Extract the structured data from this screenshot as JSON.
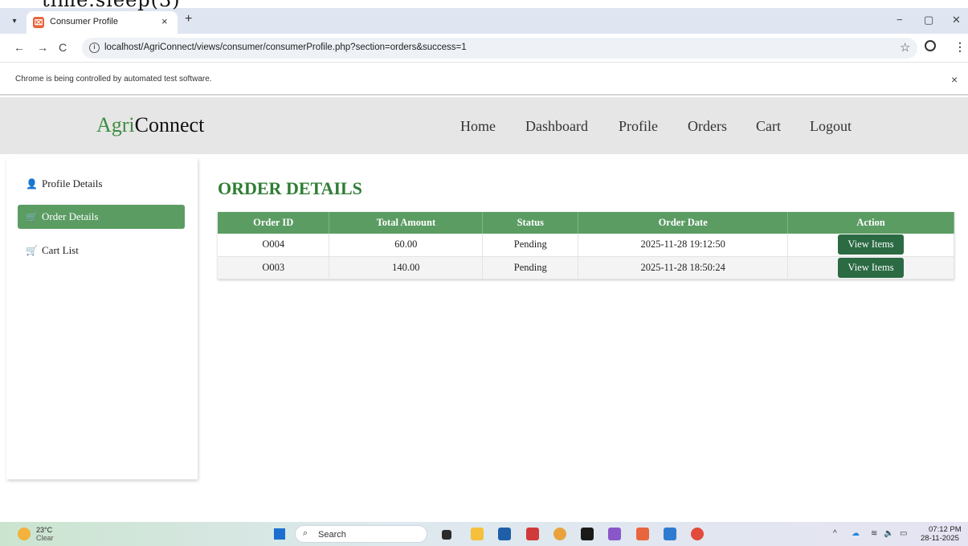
{
  "overlay_code": "time.sleep(3)",
  "browser": {
    "tab_title": "Consumer Profile",
    "tab_close": "×",
    "new_tab": "+",
    "url": "localhost/AgriConnect/views/consumer/consumerProfile.php?section=orders&success=1",
    "automation_notice": "Chrome is being controlled by automated test software.",
    "bar_close": "×",
    "back": "←",
    "forward": "→",
    "reload": "C",
    "bookmark": "☆",
    "menu": "⋮",
    "minimize": "−",
    "restore": "▢",
    "close": "✕",
    "tab_menu": "▾"
  },
  "site": {
    "logo_part1": "Agri",
    "logo_part2": "Connect",
    "nav": {
      "home": "Home",
      "dashboard": "Dashboard",
      "profile": "Profile",
      "orders": "Orders",
      "cart": "Cart",
      "logout": "Logout"
    }
  },
  "sidebar": {
    "profile_details": "Profile Details",
    "order_details": "Order Details",
    "cart_list": "Cart List"
  },
  "main": {
    "title": "ORDER DETAILS",
    "table": {
      "headers": [
        "Order ID",
        "Total Amount",
        "Status",
        "Order Date",
        "Action"
      ],
      "rows": [
        {
          "id": "O004",
          "total": "60.00",
          "status": "Pending",
          "date": "2025-11-28 19:12:50",
          "action": "View Items"
        },
        {
          "id": "O003",
          "total": "140.00",
          "status": "Pending",
          "date": "2025-11-28 18:50:24",
          "action": "View Items"
        }
      ]
    }
  },
  "taskbar": {
    "temp": "23°C",
    "weather": "Clear",
    "search": "Search",
    "time": "07:12 PM",
    "date": "28-11-2025",
    "tray_arrow": "^"
  },
  "colors": {
    "brand_green": "#3c8d40",
    "table_header": "#5b9c63",
    "button_green": "#2b6a43"
  }
}
